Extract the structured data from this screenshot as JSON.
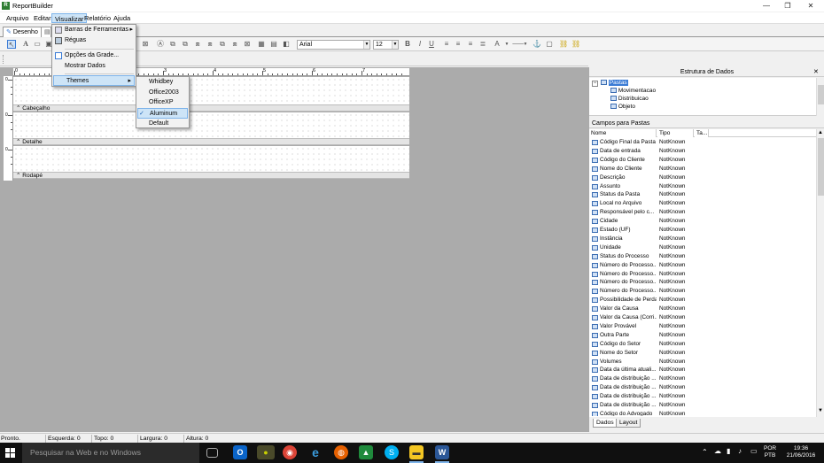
{
  "window": {
    "title": "ReportBuilder",
    "icon_letter": "R",
    "minimize_glyph": "—",
    "maximize_glyph": "❐",
    "close_glyph": "✕"
  },
  "menu": [
    "Arquivo",
    "Editar",
    "Visualizar",
    "Relatório",
    "Ajuda"
  ],
  "tabs": {
    "design": "Desenho"
  },
  "toolbar": {
    "font_name": "Arial",
    "font_size": "12"
  },
  "ruler_labels": [
    "0",
    "1",
    "2",
    "3",
    "4",
    "5",
    "6",
    "7",
    "8"
  ],
  "bands": [
    "Cabeçalho",
    "Detalhe",
    "Rodapé"
  ],
  "visualizar_menu": {
    "items": [
      "Barras de Ferramentas",
      "Réguas",
      "Opções da Grade...",
      "Mostrar Dados",
      "Themes"
    ],
    "arrow": "▸"
  },
  "themes_menu": {
    "items": [
      "Whidbey",
      "Office2003",
      "OfficeXP",
      "Aluminum",
      "Default"
    ],
    "checked": "Aluminum",
    "check_glyph": "✓"
  },
  "data_panel": {
    "title": "Estrutura de Dados",
    "close_glyph": "✕",
    "tree": {
      "root": "Pastas",
      "expander": "−",
      "children": [
        "Movimentacao",
        "Distribuicao",
        "Objeto"
      ]
    },
    "fields_title": "Campos para Pastas",
    "columns": [
      "Nome",
      "Tipo",
      "Ta..."
    ],
    "fields": [
      [
        "Código Final da Pasta",
        "NotKnown"
      ],
      [
        "Data de entrada",
        "NotKnown"
      ],
      [
        "Código do Cliente",
        "NotKnown"
      ],
      [
        "Nome do Cliente",
        "NotKnown"
      ],
      [
        "Descrição",
        "NotKnown"
      ],
      [
        "Assunto",
        "NotKnown"
      ],
      [
        "Status da Pasta",
        "NotKnown"
      ],
      [
        "Local no Arquivo",
        "NotKnown"
      ],
      [
        "Responsável pelo c...",
        "NotKnown"
      ],
      [
        "Cidade",
        "NotKnown"
      ],
      [
        "Estado (UF)",
        "NotKnown"
      ],
      [
        "Instância",
        "NotKnown"
      ],
      [
        "Unidade",
        "NotKnown"
      ],
      [
        "Status do Processo",
        "NotKnown"
      ],
      [
        "Número do Processo...",
        "NotKnown"
      ],
      [
        "Número do Processo...",
        "NotKnown"
      ],
      [
        "Número do Processo...",
        "NotKnown"
      ],
      [
        "Número do Processo...",
        "NotKnown"
      ],
      [
        "Possibilidade de Perda",
        "NotKnown"
      ],
      [
        "Valor da Causa",
        "NotKnown"
      ],
      [
        "Valor da Causa (Corri...",
        "NotKnown"
      ],
      [
        "Valor Provável",
        "NotKnown"
      ],
      [
        "Outra Parte",
        "NotKnown"
      ],
      [
        "Código do Setor",
        "NotKnown"
      ],
      [
        "Nome do Setor",
        "NotKnown"
      ],
      [
        "Volumes",
        "NotKnown"
      ],
      [
        "Data da última atuali...",
        "NotKnown"
      ],
      [
        "Data de distribuição ...",
        "NotKnown"
      ],
      [
        "Data de distribuição ...",
        "NotKnown"
      ],
      [
        "Data de distribuição ...",
        "NotKnown"
      ],
      [
        "Data de distribuição ...",
        "NotKnown"
      ],
      [
        "Código do Advogado",
        "NotKnown"
      ]
    ],
    "bottom_tabs": [
      "Dados",
      "Layout"
    ]
  },
  "status": {
    "ready": "Pronto.",
    "left": "Esquerda: 0",
    "top": "Topo: 0",
    "width": "Largura: 0",
    "height": "Altura: 0"
  },
  "taskbar": {
    "search_placeholder": "Pesquisar na Web e no Windows",
    "lang_top": "POR",
    "lang_bottom": "PTB",
    "time": "19:36",
    "date": "21/06/2016"
  },
  "colors": {
    "accent": "#3a7bd5",
    "workarea": "#ababab",
    "taskbar": "#101010",
    "menu_highlight": "#cde4f7"
  }
}
